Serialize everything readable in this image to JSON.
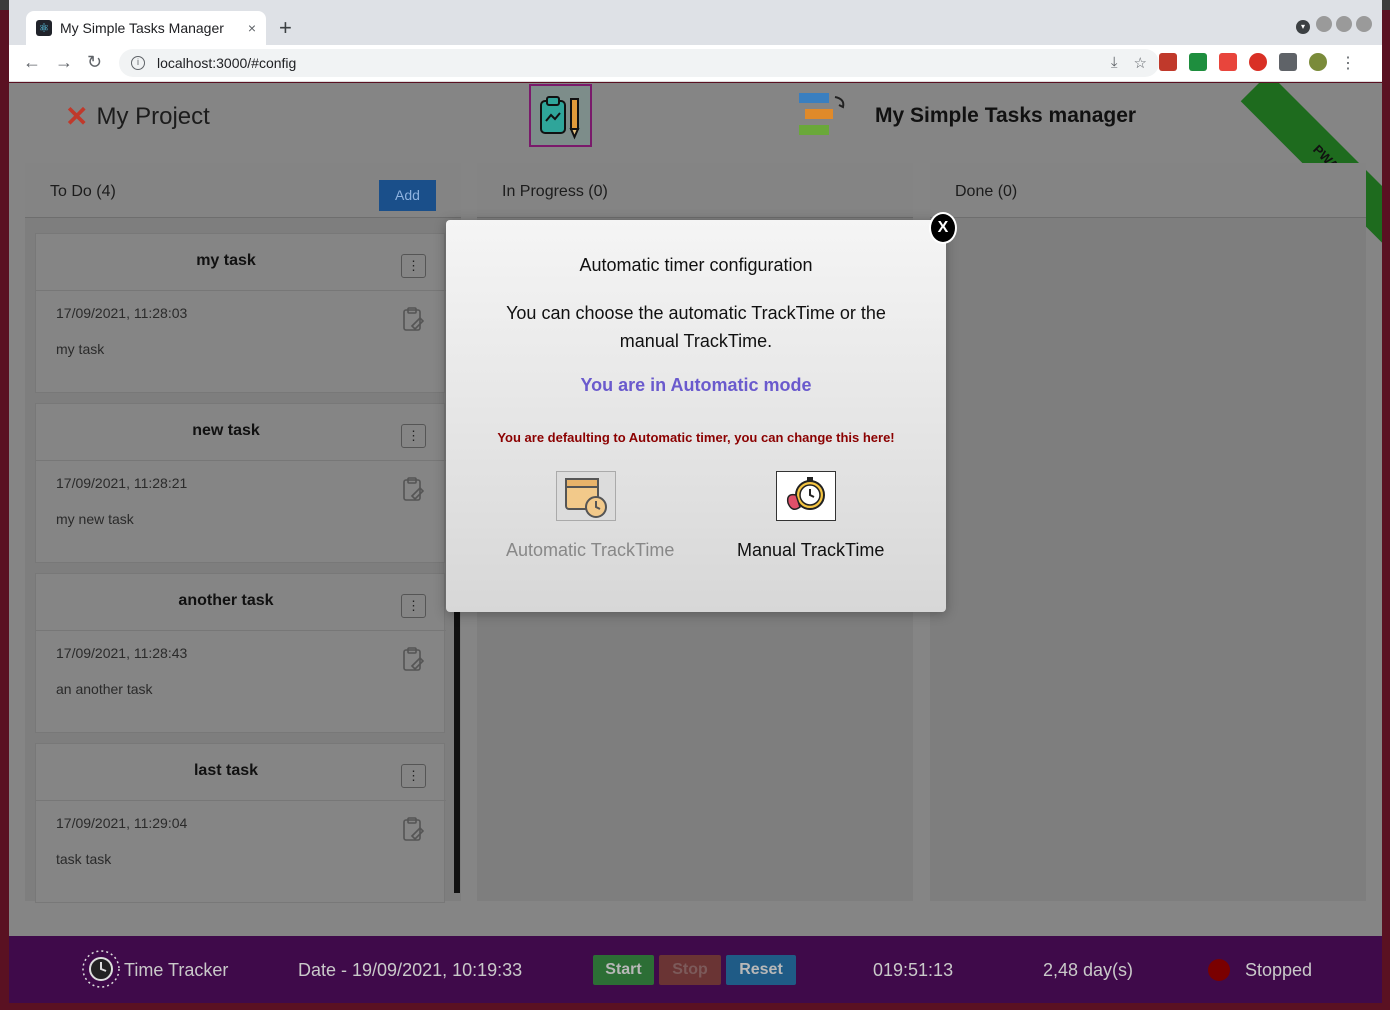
{
  "browser": {
    "tab_title": "My Simple Tasks Manager",
    "tab_close": "×",
    "new_tab": "+",
    "url": "localhost:3000/#config"
  },
  "header": {
    "project_name": "My Project",
    "app_title": "My Simple Tasks manager",
    "ribbon_text": "PWA"
  },
  "columns": {
    "todo": {
      "title": "To Do (4)",
      "add_label": "Add"
    },
    "in_progress": {
      "title": "In Progress (0)"
    },
    "done": {
      "title": "Done (0)"
    }
  },
  "tasks": [
    {
      "title": "my task",
      "date": "17/09/2021, 11:28:03",
      "desc": "my task"
    },
    {
      "title": "new task",
      "date": "17/09/2021, 11:28:21",
      "desc": "my new task"
    },
    {
      "title": "another task",
      "date": "17/09/2021, 11:28:43",
      "desc": "an another task"
    },
    {
      "title": "last task",
      "date": "17/09/2021, 11:29:04",
      "desc": "task task"
    }
  ],
  "modal": {
    "close_label": "X",
    "title": "Automatic timer configuration",
    "text": "You can choose the automatic TrackTime or the manual TrackTime.",
    "mode": "You are in Automatic mode",
    "warning": "You are defaulting to Automatic timer, you can change this here!",
    "auto_label": "Automatic TrackTime",
    "manual_label": "Manual TrackTime"
  },
  "timebar": {
    "label": "Time Tracker",
    "date": "Date - 19/09/2021, 10:19:33",
    "start": "Start",
    "stop": "Stop",
    "reset": "Reset",
    "elapsed": "019:51:13",
    "days": "2,48 day(s)",
    "status": "Stopped",
    "status_color": "#7a0000"
  },
  "icons": {
    "menu": "⋮",
    "back": "←",
    "forward": "→",
    "reload": "↻",
    "star": "☆",
    "info": "i",
    "tab_dropdown": "▾",
    "project_close": "✕"
  }
}
